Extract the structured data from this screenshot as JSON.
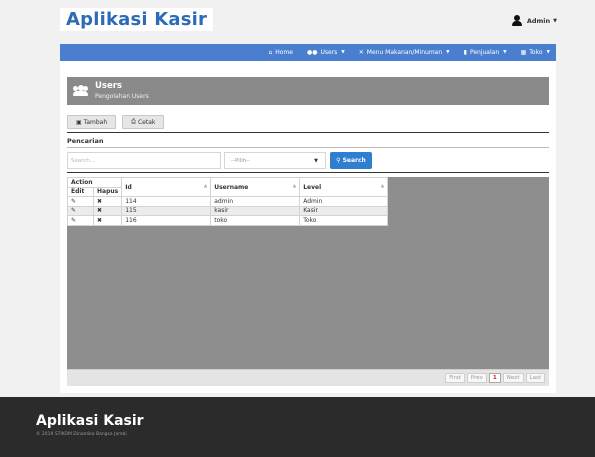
{
  "header": {
    "brand": "Aplikasi Kasir",
    "user_label": "Admin"
  },
  "nav": [
    {
      "icon": "home-icon",
      "glyph": "⌂",
      "label": "Home",
      "caret": false
    },
    {
      "icon": "users-icon",
      "glyph": "👥",
      "label": "Users",
      "caret": true
    },
    {
      "icon": "utensils-icon",
      "glyph": "🍴",
      "label": "Menu Makanan/Minuman",
      "caret": true
    },
    {
      "icon": "bar-chart-icon",
      "glyph": "📊",
      "label": "Penjualan",
      "caret": true
    },
    {
      "icon": "store-icon",
      "glyph": "▦",
      "label": "Toko",
      "caret": true
    }
  ],
  "panel": {
    "title": "Users",
    "subtitle": "Pengolahan Users"
  },
  "toolbar": {
    "add_label": "Tambah",
    "print_label": "Cetak"
  },
  "search": {
    "label": "Pencarian",
    "placeholder": "Search...",
    "select_value": "--Pilih--",
    "button_label": "Search"
  },
  "table": {
    "group_header": "Action",
    "sub_headers": [
      "Edit",
      "Hapus"
    ],
    "columns": [
      "Id",
      "Username",
      "Level"
    ],
    "rows": [
      {
        "id": "114",
        "username": "admin",
        "level": "Admin"
      },
      {
        "id": "115",
        "username": "kasir",
        "level": "Kasir"
      },
      {
        "id": "116",
        "username": "toko",
        "level": "Toko"
      }
    ]
  },
  "pager": {
    "first": "First",
    "prev": "Prev",
    "current": "1",
    "next": "Next",
    "last": "Last"
  },
  "footer": {
    "title": "Aplikasi Kasir",
    "copyright": "© 2019 STIKOM Dinamika Bangsa Jambi"
  }
}
